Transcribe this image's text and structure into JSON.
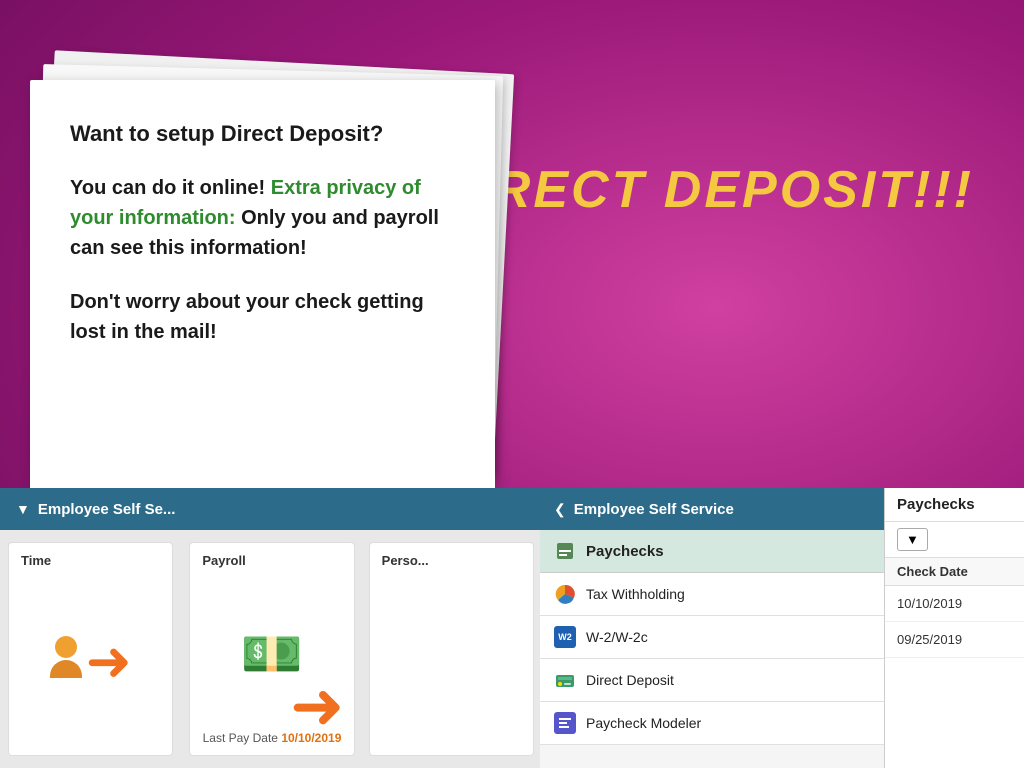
{
  "background": {
    "color": "#c0308a"
  },
  "title": {
    "text": "DIRECT DEPOSIT!!!"
  },
  "paper": {
    "heading": "Want to setup Direct Deposit?",
    "paragraph1_plain": "You can do it online!",
    "paragraph1_green": "Extra privacy of your information:",
    "paragraph1_rest": "Only you and payroll can see this information!",
    "paragraph2": "Don't worry about your check getting lost in the mail!"
  },
  "ess_bar": {
    "arrow": "▼",
    "label": "Employee Self Se..."
  },
  "ess_header": {
    "chevron": "❮",
    "label": "Employee Self Service"
  },
  "cards": {
    "time": {
      "label": "Time"
    },
    "payroll": {
      "label": "Payroll",
      "last_pay_label": "Last Pay Date",
      "last_pay_date": "10/10/2019"
    },
    "personal": {
      "label": "Perso..."
    }
  },
  "menu": {
    "section_label": "Paychecks",
    "items": [
      {
        "id": "tax-withholding",
        "label": "Tax Withholding",
        "icon_type": "pie",
        "has_chevron": false
      },
      {
        "id": "w2",
        "label": "W-2/W-2c",
        "icon_type": "w2",
        "has_chevron": true
      },
      {
        "id": "direct-deposit",
        "label": "Direct Deposit",
        "icon_type": "dd",
        "has_chevron": false
      },
      {
        "id": "paycheck-modeler",
        "label": "Paycheck Modeler",
        "icon_type": "pm",
        "has_chevron": false
      }
    ]
  },
  "paychecks_panel": {
    "header": "Paychecks",
    "filter_icon": "▼",
    "col_header": "Check Date",
    "dates": [
      "10/10/2019",
      "09/25/2019"
    ]
  }
}
